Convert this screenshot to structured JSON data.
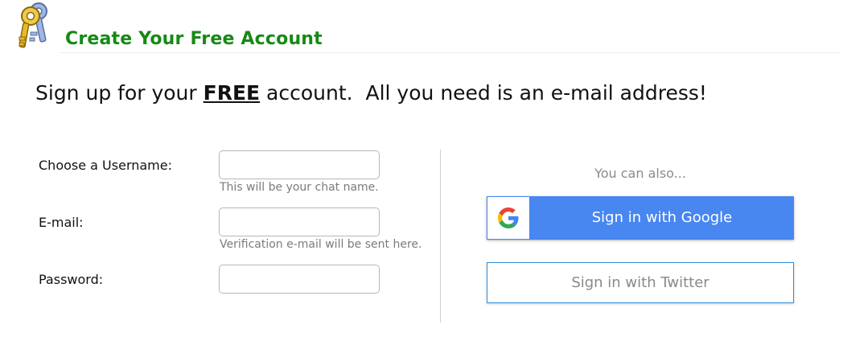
{
  "header": {
    "title": "Create Your Free Account",
    "icon": "keys-icon"
  },
  "intro": {
    "before": "Sign up for your ",
    "emphasis": "FREE",
    "after": " account.  All you need is an e-mail address!"
  },
  "form": {
    "username": {
      "label": "Choose a Username:",
      "value": "",
      "placeholder": "",
      "hint": "This will be your chat name."
    },
    "email": {
      "label": "E-mail:",
      "value": "",
      "placeholder": "",
      "hint": "Verification e-mail will be sent here."
    },
    "password": {
      "label": "Password:",
      "value": "",
      "placeholder": ""
    }
  },
  "social": {
    "also_text": "You can also...",
    "google_label": "Sign in with Google",
    "google_icon": "google-g-icon",
    "twitter_label": "Sign in with Twitter"
  },
  "colors": {
    "title_green": "#158a15",
    "google_blue": "#4886f0",
    "twitter_border": "#2d8fdc",
    "hint_gray": "#7c7c7c"
  }
}
